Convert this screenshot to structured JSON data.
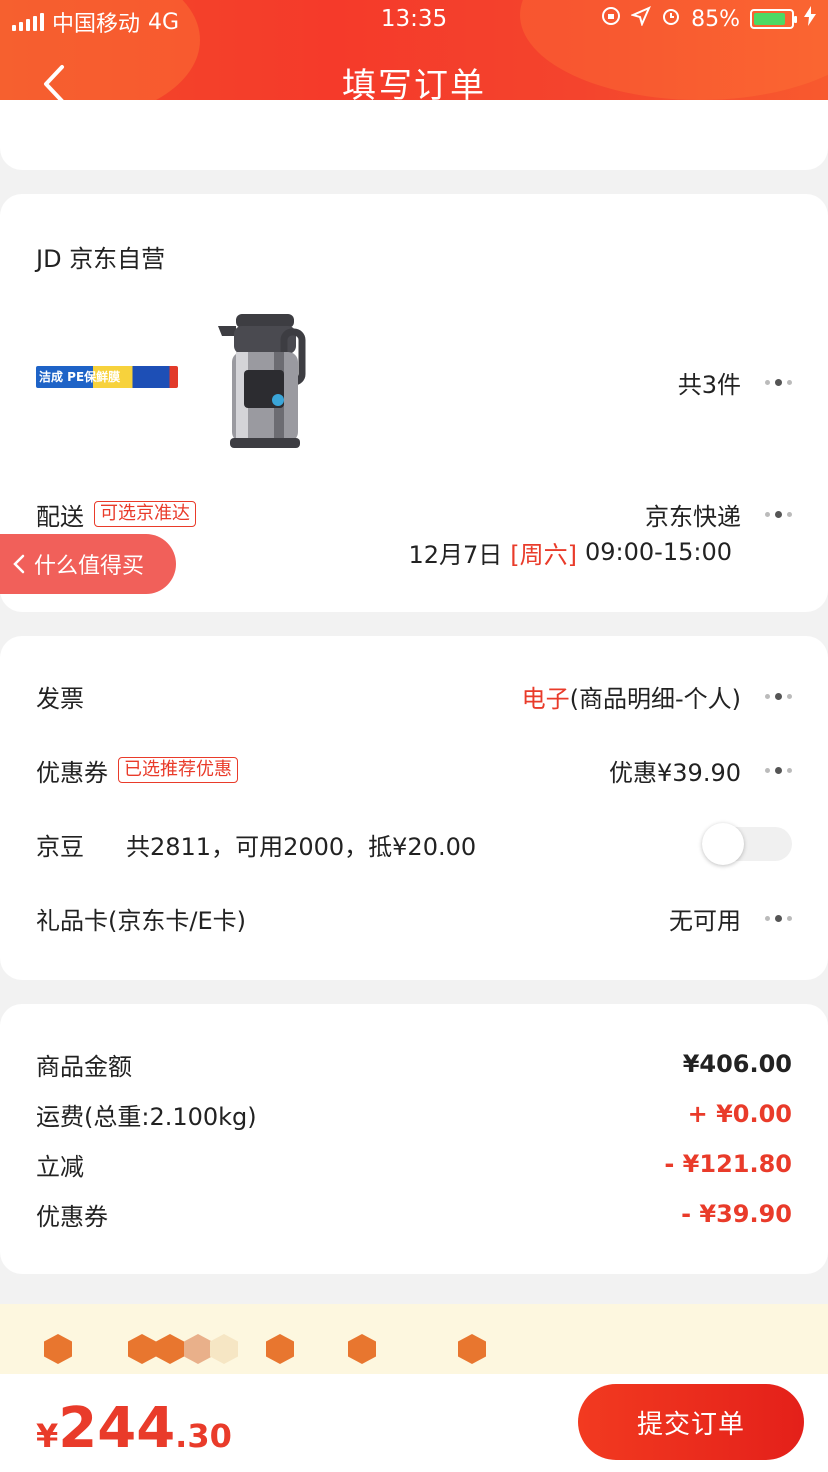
{
  "status_bar": {
    "carrier": "中国移动",
    "network": "4G",
    "time": "13:35",
    "battery": "85%",
    "battery_level": 0.85
  },
  "header": {
    "title": "填写订单"
  },
  "store": {
    "name": "JD 京东自营",
    "products": [
      {
        "name": "plastic-wrap-product",
        "image_text": "洁成 PE保鲜膜"
      },
      {
        "name": "thermos-product"
      }
    ],
    "count_label": "共3件"
  },
  "delivery": {
    "label": "配送",
    "tag": "可选京准达",
    "carrier": "京东快递",
    "date": "12月7日",
    "weekday": "[周六]",
    "time_range": "09:00-15:00"
  },
  "floating_button": {
    "label": "什么值得买"
  },
  "options": {
    "invoice": {
      "label": "发票",
      "value_highlight": "电子",
      "value_rest": "(商品明细-个人)"
    },
    "coupon": {
      "label": "优惠券",
      "tag": "已选推荐优惠",
      "value": "优惠¥39.90"
    },
    "jingdou": {
      "label": "京豆",
      "detail": "共2811，可用2000，抵¥20.00",
      "enabled": false
    },
    "gift_card": {
      "label": "礼品卡(京东卡/E卡)",
      "value": "无可用"
    }
  },
  "summary": {
    "items": [
      {
        "label": "商品金额",
        "value": "¥406.00",
        "color": "#222222"
      },
      {
        "label": "运费(总重:2.100kg)",
        "value": "+ ¥0.00",
        "color": "#e93b2a"
      },
      {
        "label": "立减",
        "value": "- ¥121.80",
        "color": "#e93b2a"
      },
      {
        "label": "优惠券",
        "value": "- ¥39.90",
        "color": "#e93b2a"
      }
    ]
  },
  "footer": {
    "currency": "¥",
    "total_int": "244",
    "total_dec": ".30",
    "submit_label": "提交订单"
  },
  "colors": {
    "accent": "#e93b2a",
    "header": "#f4442d",
    "banner_bg": "#fdf7df",
    "hex": "#e8762f"
  }
}
